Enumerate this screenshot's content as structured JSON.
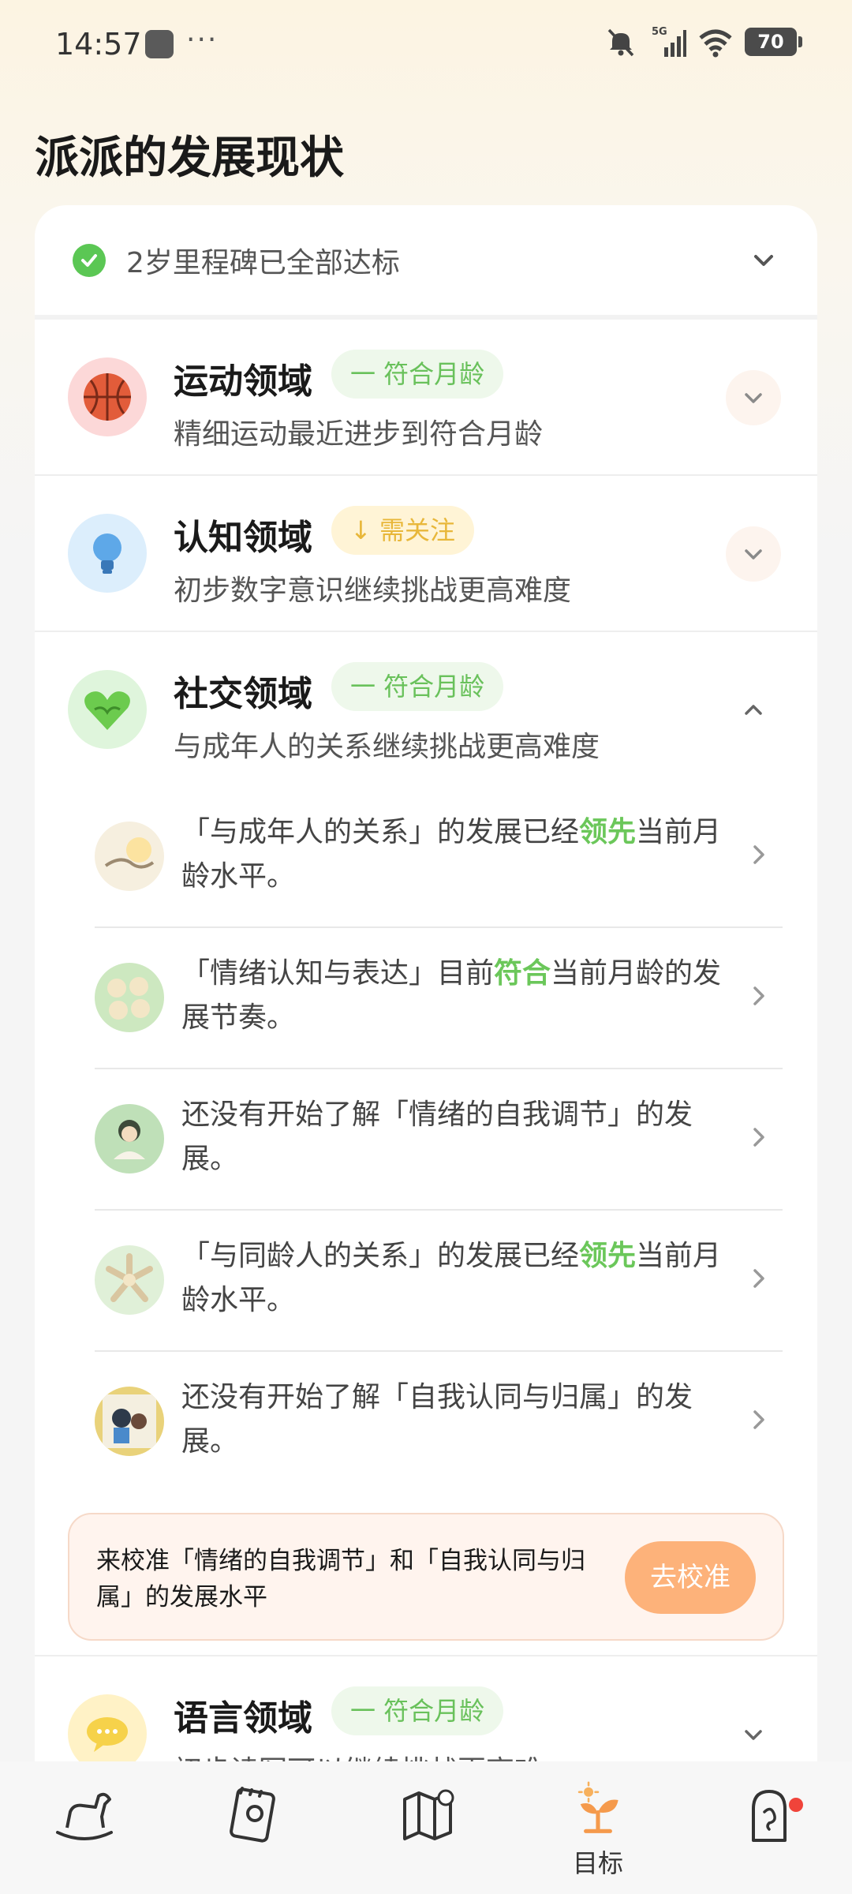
{
  "status_bar": {
    "time": "14:57",
    "dots": "···",
    "network": "5G",
    "battery": "70"
  },
  "page": {
    "title": "派派的发展现状"
  },
  "milestone": {
    "text": "2岁里程碑已全部达标"
  },
  "domains": [
    {
      "name": "运动领域",
      "tag": "一 符合月龄",
      "desc": "精细运动最近进步到符合月龄"
    },
    {
      "name": "认知领域",
      "tag": "↓ 需关注",
      "desc": "初步数字意识继续挑战更高难度"
    },
    {
      "name": "社交领域",
      "tag": "一 符合月龄",
      "desc": "与成年人的关系继续挑战更高难度"
    },
    {
      "name": "语言领域",
      "tag": "一 符合月龄",
      "desc": "初步读写可以继续挑战更高难"
    }
  ],
  "social_items": [
    {
      "pre": "「与成年人的关系」的发展已经",
      "hl": "领先",
      "post": "当前月龄水平。"
    },
    {
      "pre": "「情绪认知与表达」目前",
      "hl": "符合",
      "post": "当前月龄的发展节奏。"
    },
    {
      "pre": "还没有开始了解「情绪的自我调节」的发展。",
      "hl": "",
      "post": ""
    },
    {
      "pre": "「与同龄人的关系」的发展已经",
      "hl": "领先",
      "post": "当前月龄水平。"
    },
    {
      "pre": "还没有开始了解「自我认同与归属」的发展。",
      "hl": "",
      "post": ""
    }
  ],
  "calibrate": {
    "text": "来校准「情绪的自我调节」和「自我认同与归属」的发展水平",
    "button": "去校准"
  },
  "bottom_nav": {
    "goal_label": "目标"
  },
  "colors": {
    "accent_green": "#6BC75A",
    "accent_orange": "#FDB27A",
    "warning_yellow": "#E8B73A",
    "notification_red": "#F0443A"
  }
}
